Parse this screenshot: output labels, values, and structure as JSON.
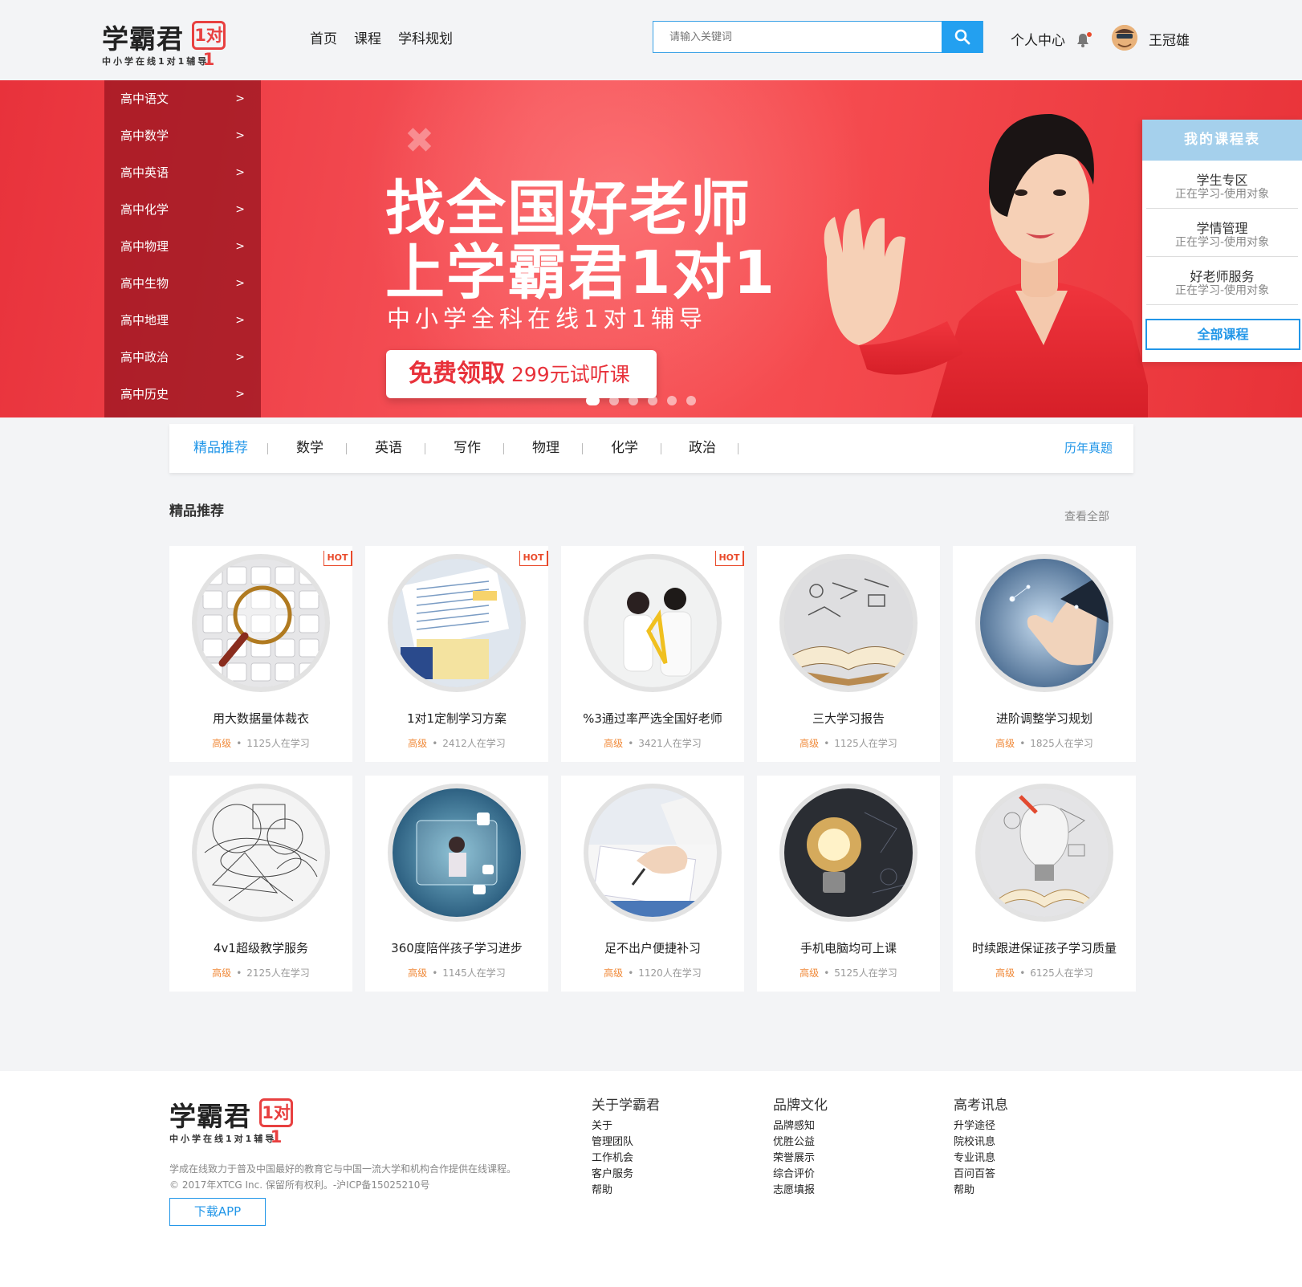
{
  "brand": {
    "name": "学霸君",
    "badge": "1对1",
    "tagline": "中小学在线1对1辅导"
  },
  "nav": [
    "首页",
    "课程",
    "学科规划"
  ],
  "search": {
    "placeholder": "请输入关键词"
  },
  "user": {
    "center": "个人中心",
    "name": "王冠雄"
  },
  "banner": {
    "line1": "找全国好老师",
    "line2": "上学霸君1对1",
    "sub": "中小学全科在线1对1辅导",
    "cta_strong": "免费领取",
    "cta_light": "299元试听课",
    "slide_count": 6,
    "active_slide": 1
  },
  "categories": [
    "高中语文",
    "高中数学",
    "高中英语",
    "高中化学",
    "高中物理",
    "高中生物",
    "高中地理",
    "高中政治",
    "高中历史"
  ],
  "category_arrow": ">",
  "schedule": {
    "title": "我的课程表",
    "items": [
      {
        "title": "学生专区",
        "sub": "正在学习-使用对象"
      },
      {
        "title": "学情管理",
        "sub": "正在学习-使用对象"
      },
      {
        "title": "好老师服务",
        "sub": "正在学习-使用对象"
      }
    ],
    "all": "全部课程"
  },
  "tabs": [
    "精品推荐",
    "数学",
    "英语",
    "写作",
    "物理",
    "化学",
    "政治"
  ],
  "tab_right": "历年真题",
  "section": {
    "title": "精品推荐",
    "view_all": "查看全部"
  },
  "cards": [
    {
      "title": "用大数据量体裁衣",
      "level": "高级",
      "learners": "1125人在学习",
      "hot": true,
      "icon": "magnifier-keyboard"
    },
    {
      "title": "1对1定制学习方案",
      "level": "高级",
      "learners": "2412人在学习",
      "hot": true,
      "icon": "study-papers"
    },
    {
      "title": "%3通过率严选全国好老师",
      "level": "高级",
      "learners": "3421人在学习",
      "hot": true,
      "icon": "teachers"
    },
    {
      "title": "三大学习报告",
      "level": "高级",
      "learners": "1125人在学习",
      "hot": false,
      "icon": "open-book"
    },
    {
      "title": "进阶调整学习规划",
      "level": "高级",
      "learners": "1825人在学习",
      "hot": false,
      "icon": "touch-hand"
    },
    {
      "title": "4v1超级教学服务",
      "level": "高级",
      "learners": "2125人在学习",
      "hot": false,
      "icon": "math-sketch"
    },
    {
      "title": "360度陪伴孩子学习进步",
      "level": "高级",
      "learners": "1145人在学习",
      "hot": false,
      "icon": "tablet-learning"
    },
    {
      "title": "足不出户便捷补习",
      "level": "高级",
      "learners": "1120人在学习",
      "hot": false,
      "icon": "writing-hand"
    },
    {
      "title": "手机电脑均可上课",
      "level": "高级",
      "learners": "5125人在学习",
      "hot": false,
      "icon": "lightbulb-dark"
    },
    {
      "title": "时续跟进保证孩子学习质量",
      "level": "高级",
      "learners": "6125人在学习",
      "hot": false,
      "icon": "lightbulb-book"
    }
  ],
  "hot_label": "HOT",
  "meta_sep": "•",
  "footer": {
    "desc1": "学成在线致力于普及中国最好的教育它与中国一流大学和机构合作提供在线课程。",
    "desc2": "© 2017年XTCG Inc. 保留所有权利。-沪ICP备15025210号",
    "download": "下载APP",
    "columns": [
      {
        "title": "关于学霸君",
        "links": [
          "关于",
          "管理团队",
          "工作机会",
          "客户服务",
          "帮助"
        ]
      },
      {
        "title": "品牌文化",
        "links": [
          "品牌感知",
          "优胜公益",
          "荣誉展示",
          "综合评价",
          "志愿填报"
        ]
      },
      {
        "title": "高考讯息",
        "links": [
          "升学途径",
          "院校讯息",
          "专业讯息",
          "百问百答",
          "帮助"
        ]
      }
    ]
  },
  "colors": {
    "accent": "#2196e8",
    "banner": "#f5484e",
    "hot": "#e94a2b",
    "level": "#f08a3a"
  }
}
